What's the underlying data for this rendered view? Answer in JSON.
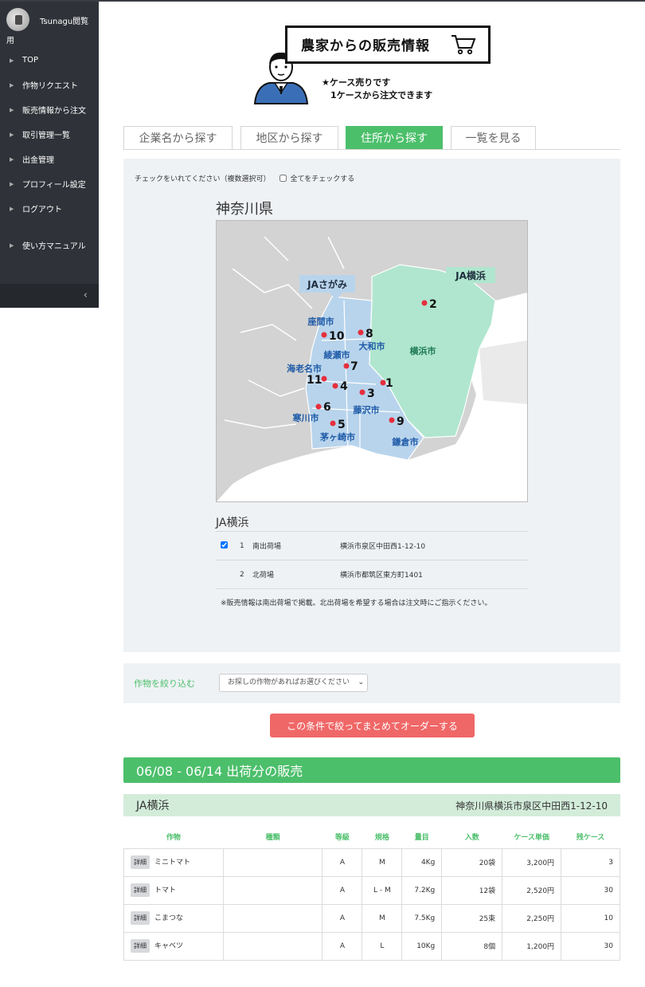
{
  "sidebar": {
    "username": "Tsunagu閲覧用",
    "items": [
      {
        "label": "TOP"
      },
      {
        "label": "作物リクエスト"
      },
      {
        "label": "販売情報から注文"
      },
      {
        "label": "取引管理一覧"
      },
      {
        "label": "出金管理"
      },
      {
        "label": "プロフィール設定"
      },
      {
        "label": "ログアウト"
      },
      {
        "label": "使い方マニュアル"
      }
    ]
  },
  "header": {
    "title": "農家からの販売情報",
    "note": "★ケース売りです\n　1ケースから注文できます"
  },
  "tabs": [
    {
      "label": "企業名から探す",
      "active": false
    },
    {
      "label": "地区から探す",
      "active": false
    },
    {
      "label": "住所から探す",
      "active": true
    },
    {
      "label": "一覧を見る",
      "active": false
    }
  ],
  "search": {
    "instruction": "チェックをいれてください（複数選択可）",
    "check_all_label": "全てをチェックする",
    "prefecture": "神奈川県",
    "map": {
      "group_labels": [
        "JAさがみ",
        "JA横浜"
      ],
      "cities": [
        "座間市",
        "大和市",
        "綾瀬市",
        "海老名市",
        "横浜市",
        "寒川市",
        "藤沢市",
        "茅ヶ崎市",
        "鎌倉市"
      ],
      "markers": [
        "1",
        "2",
        "3",
        "4",
        "5",
        "6",
        "7",
        "8",
        "9",
        "10",
        "11"
      ]
    },
    "ja_name": "JA横浜",
    "locations": [
      {
        "no": "1",
        "name": "南出荷場",
        "address": "横浜市泉区中田西1-12-10",
        "checked": true
      },
      {
        "no": "2",
        "name": "北荷場",
        "address": "横浜市都筑区東方町1401",
        "checked": false
      }
    ],
    "note": "※販売情報は南出荷場で掲載。北出荷場を希望する場合は注文時にご指示ください。"
  },
  "filter": {
    "label": "作物を絞り込む",
    "placeholder": "お探しの作物があればお選びください"
  },
  "order_button": "この条件で絞ってまとめてオーダーする",
  "sales": {
    "period_title": "06/08 - 06/14 出荷分の販売",
    "ja_name": "JA横浜",
    "ja_address": "神奈川県横浜市泉区中田西1-12-10",
    "columns": [
      "作物",
      "種類",
      "等級",
      "規格",
      "量目",
      "入数",
      "ケース単価",
      "残ケース"
    ],
    "detail_label": "詳細",
    "rows": [
      {
        "crop": "ミニトマト",
        "variety": "",
        "grade": "A",
        "size": "M",
        "weight": "4Kg",
        "count": "20袋",
        "price": "3,200円",
        "remaining": "3"
      },
      {
        "crop": "トマト",
        "variety": "",
        "grade": "A",
        "size": "L - M",
        "weight": "7.2Kg",
        "count": "12袋",
        "price": "2,520円",
        "remaining": "30"
      },
      {
        "crop": "こまつな",
        "variety": "",
        "grade": "A",
        "size": "M",
        "weight": "7.5Kg",
        "count": "25束",
        "price": "2,250円",
        "remaining": "10"
      },
      {
        "crop": "キャベツ",
        "variety": "",
        "grade": "A",
        "size": "L",
        "weight": "10Kg",
        "count": "8個",
        "price": "1,200円",
        "remaining": "30"
      }
    ]
  },
  "colors": {
    "accent_green": "#4cbf6b",
    "order_red": "#f06767",
    "sidebar": "#2f3238",
    "sagami_region": "#b8d4ec",
    "yokohama_region": "#b0e6cf"
  }
}
